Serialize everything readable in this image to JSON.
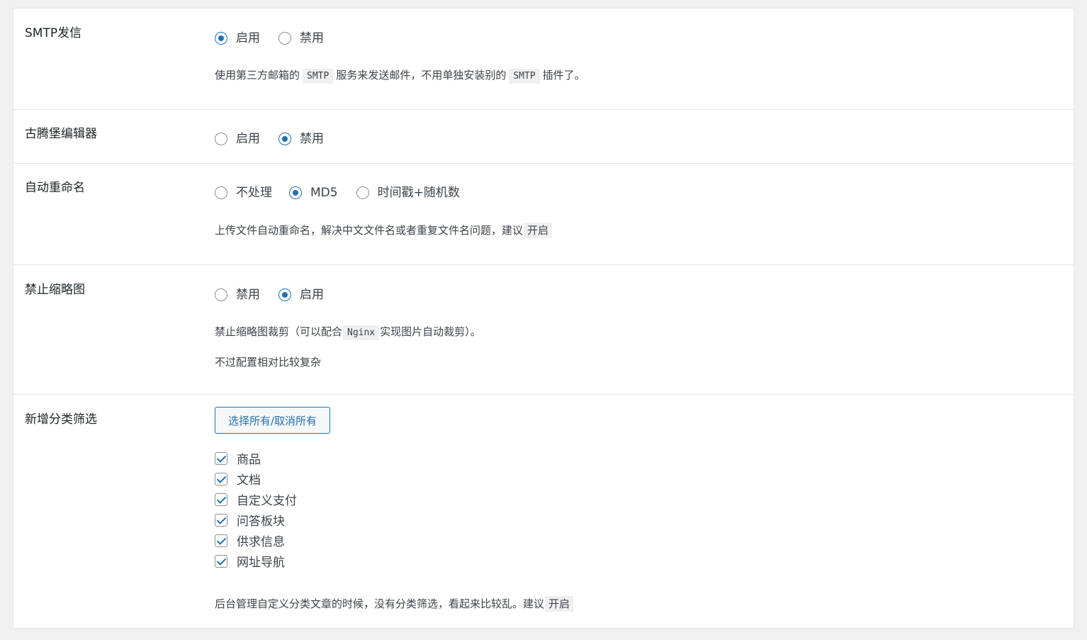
{
  "sections": {
    "smtp": {
      "label": "SMTP发信",
      "options": [
        "启用",
        "禁用"
      ],
      "selected": "启用",
      "desc_part1": "使用第三方邮箱的",
      "desc_code1": "SMTP",
      "desc_part2": "服务来发送邮件，不用单独安装别的",
      "desc_code2": "SMTP",
      "desc_part3": "插件了。"
    },
    "gutenberg": {
      "label": "古腾堡编辑器",
      "options": [
        "启用",
        "禁用"
      ],
      "selected": "禁用"
    },
    "rename": {
      "label": "自动重命名",
      "options": [
        "不处理",
        "MD5",
        "时间戳+随机数"
      ],
      "selected": "MD5",
      "desc_part1": "上传文件自动重命名，解决中文文件名或者重复文件名问题，建议",
      "desc_code1": "开启"
    },
    "thumbnail": {
      "label": "禁止缩略图",
      "options": [
        "禁用",
        "启用"
      ],
      "selected": "启用",
      "desc_part1": "禁止缩略图裁剪（可以配合",
      "desc_code1": "Nginx",
      "desc_part2": "实现图片自动裁剪）。",
      "desc_line2": "不过配置相对比较复杂"
    },
    "category_filter": {
      "label": "新增分类筛选",
      "button_label": "选择所有/取消所有",
      "items": [
        {
          "label": "商品",
          "checked": true
        },
        {
          "label": "文档",
          "checked": true
        },
        {
          "label": "自定义支付",
          "checked": true
        },
        {
          "label": "问答板块",
          "checked": true
        },
        {
          "label": "供求信息",
          "checked": true
        },
        {
          "label": "网址导航",
          "checked": true
        }
      ],
      "desc_part1": "后台管理自定义分类文章的时候，没有分类筛选，看起来比较乱。建议",
      "desc_code1": "开启"
    }
  },
  "colors": {
    "accent": "#2271b1",
    "background": "#f0f0f1",
    "panel": "#ffffff"
  }
}
